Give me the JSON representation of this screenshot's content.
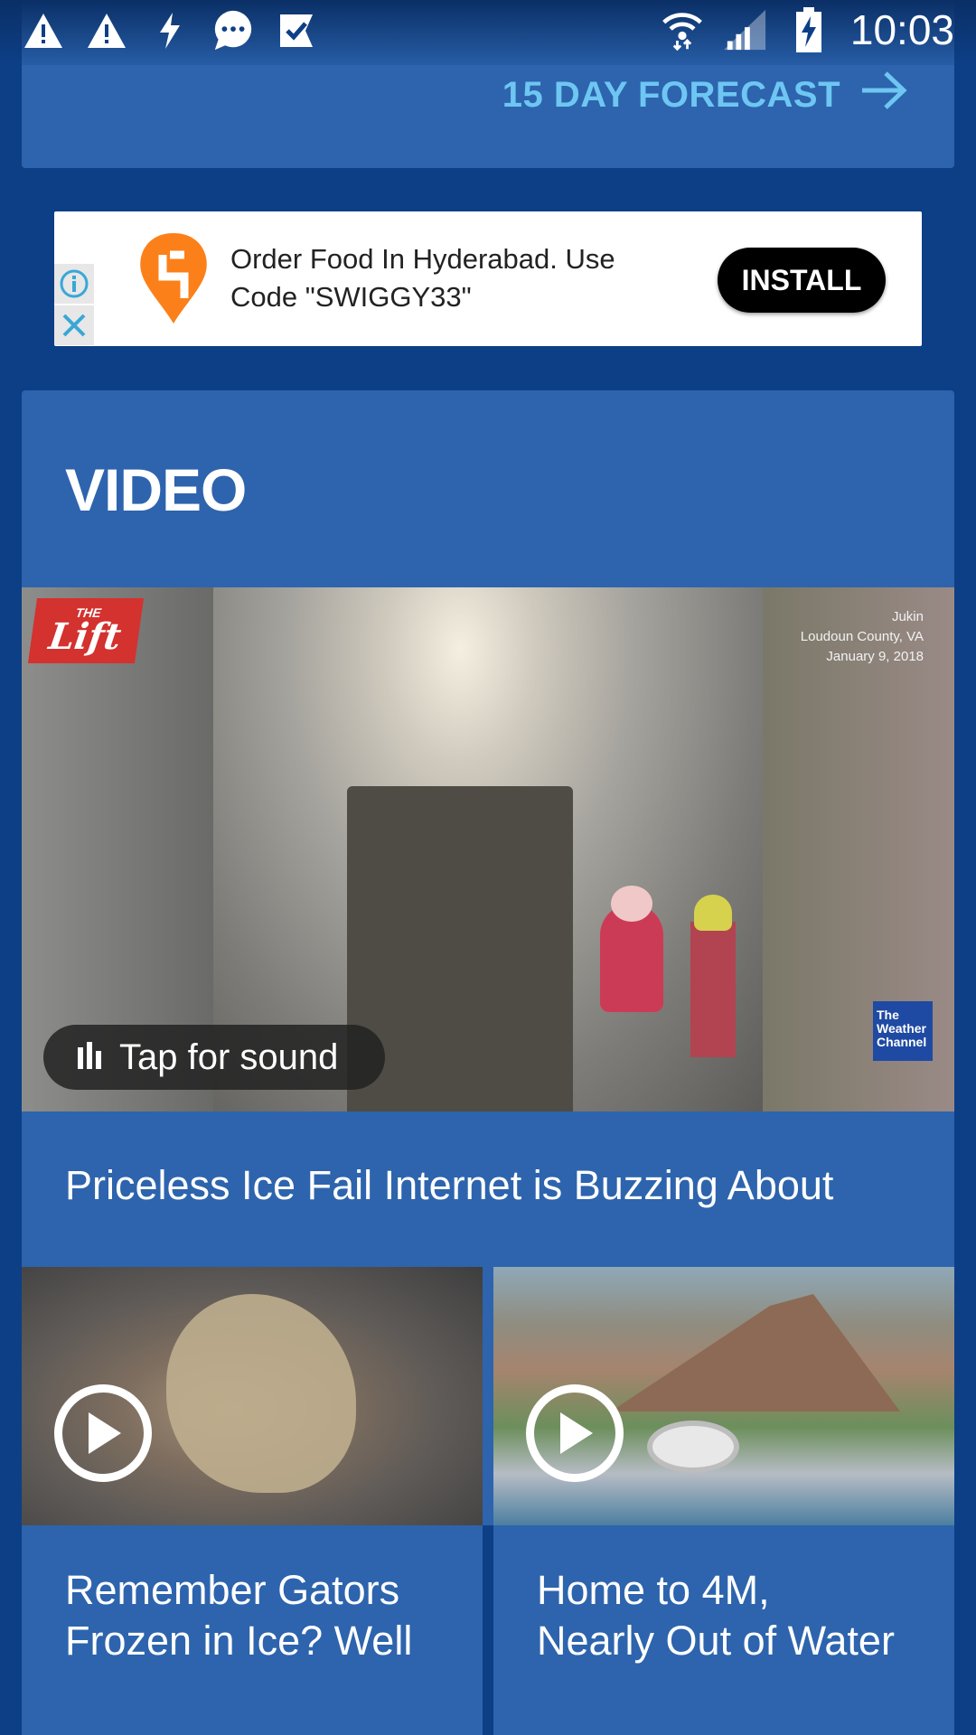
{
  "status_bar": {
    "left_icons": [
      "alert-icon",
      "alert-icon",
      "flash-icon",
      "chat-icon",
      "task-icon"
    ],
    "right_icons": [
      "wifi-icon",
      "signal-icon",
      "battery-charging-icon"
    ],
    "time": "10:03"
  },
  "forecast": {
    "link_label": "15 DAY FORECAST",
    "accent_color": "#6ec6f2"
  },
  "ad": {
    "text": "Order Food In Hyderabad. Use Code \"SWIGGY33\"",
    "install_label": "INSTALL",
    "brand_color": "#fc8019"
  },
  "video_section": {
    "title": "VIDEO",
    "main_video": {
      "logo_small": "THE",
      "logo_name": "Lift",
      "credit_lines": [
        "Jukin",
        "Loudoun County, VA",
        "January 9, 2018"
      ],
      "channel_logo": [
        "The",
        "Weather",
        "Channel"
      ],
      "sound_label": "Tap for sound",
      "headline": "Priceless Ice Fail Internet is Buzzing About"
    },
    "related": [
      {
        "caption": "Remember Gators Frozen in Ice? Well"
      },
      {
        "caption": "Home to 4M, Nearly Out of Water"
      }
    ]
  },
  "colors": {
    "background": "#0d3f87",
    "card": "#2d64ad"
  }
}
